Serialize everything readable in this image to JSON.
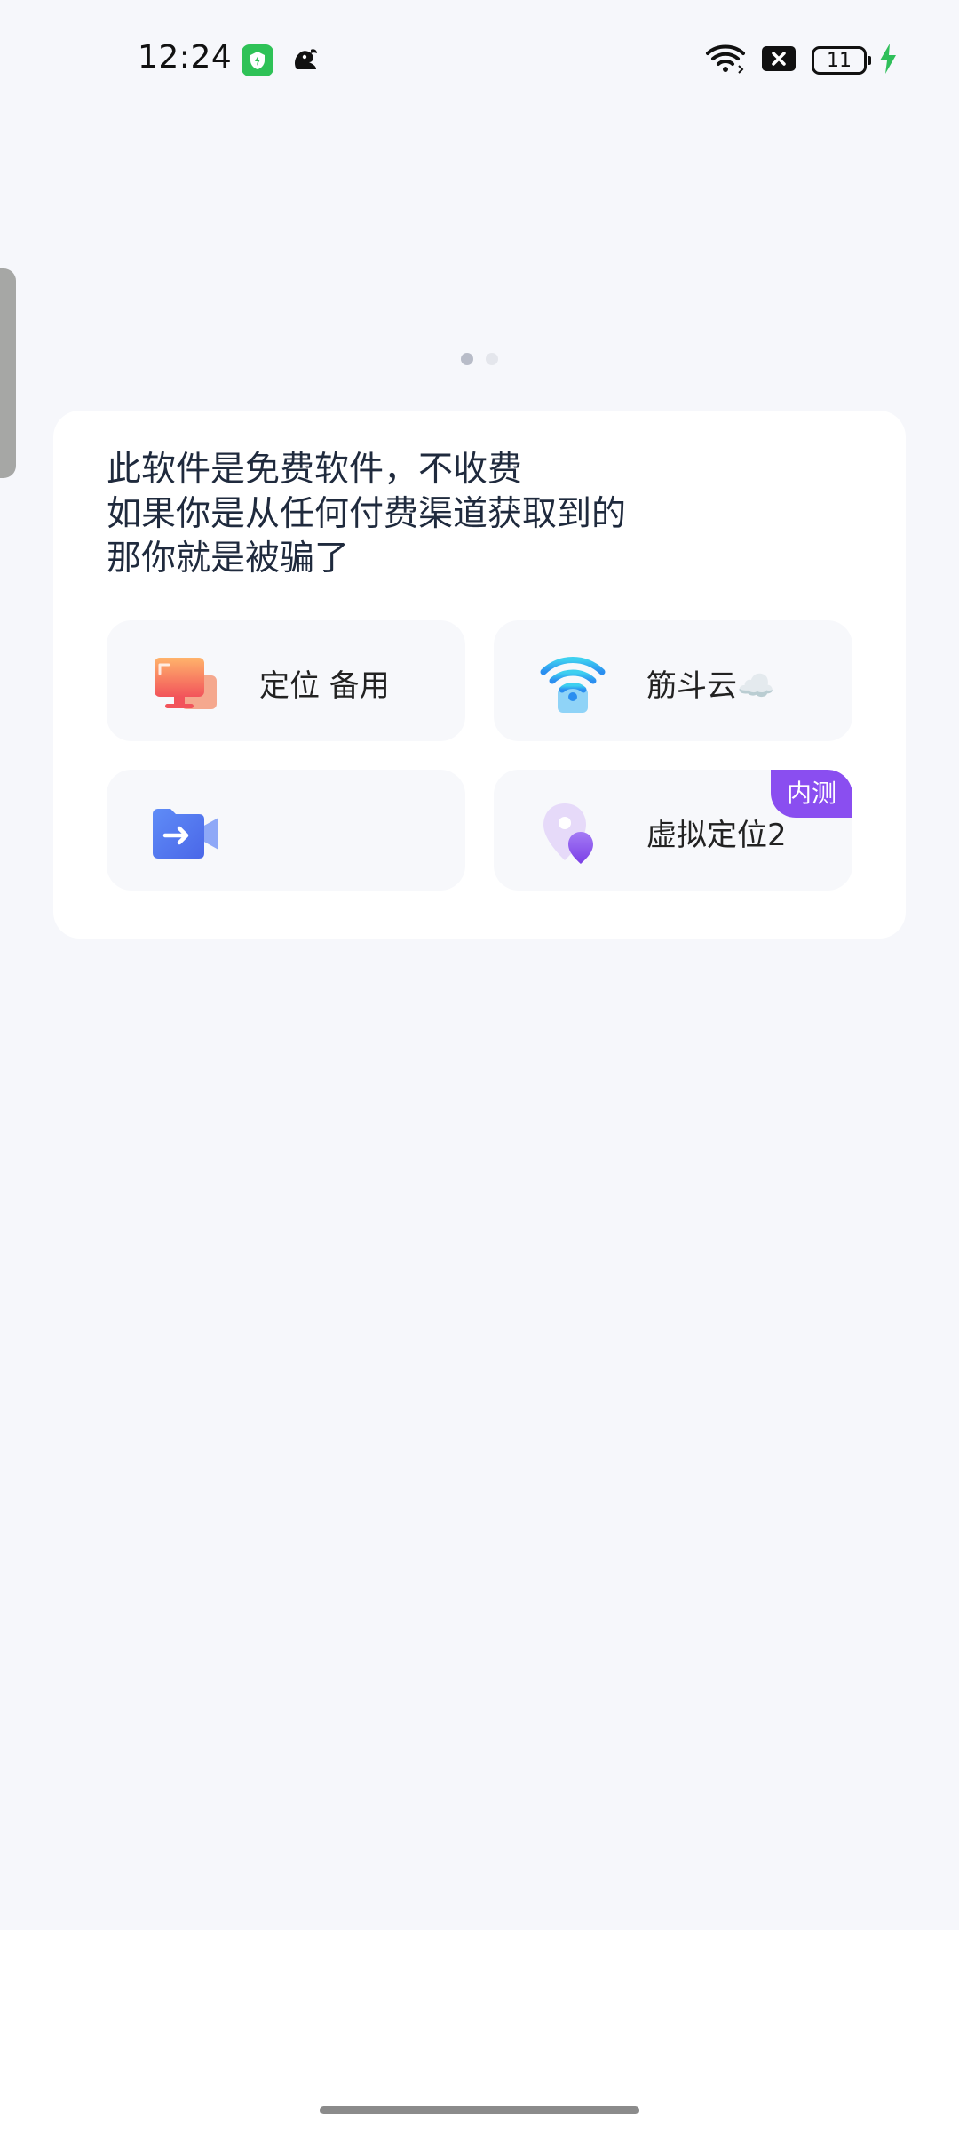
{
  "status_bar": {
    "time": "12:24",
    "battery_level": "11"
  },
  "pager": {
    "pages": 2,
    "active_index": 0
  },
  "card": {
    "notice_lines": [
      "此软件是免费软件，不收费",
      "如果你是从任何付费渠道获取到的",
      "那你就是被骗了"
    ],
    "tiles": [
      {
        "label": "定位 备用",
        "icon": "monitor-icon"
      },
      {
        "label": "筋斗云☁️",
        "icon": "wifi-icon"
      },
      {
        "label": "",
        "icon": "video-folder-icon"
      },
      {
        "label": "虚拟定位2",
        "icon": "location-pin-icon",
        "badge": "内测"
      }
    ]
  },
  "colors": {
    "background": "#f6f7fb",
    "card": "#ffffff",
    "tile": "#f7f8fb",
    "badge": "#8a4ef0",
    "text": "#1f2a3d"
  }
}
